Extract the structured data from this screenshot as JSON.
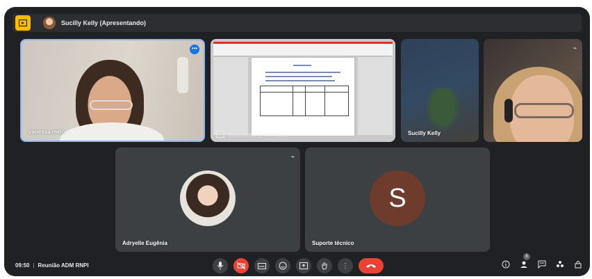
{
  "topbar": {
    "presenter_label": "Sucilly Kelly (Apresentando)"
  },
  "tiles": {
    "vanessa": {
      "name": "vanessa melo"
    },
    "share": {
      "label": "Sucilly Kelly (Apresentação)"
    },
    "sucilly": {
      "name": "Sucilly Kelly"
    },
    "adryelle": {
      "name": "Adryelle Eugênia"
    },
    "suporte": {
      "name": "Suporte técnico",
      "initial": "S"
    }
  },
  "bottombar": {
    "time": "09:50",
    "meeting_name": "Reunião ADM RNPI",
    "participants_count": "6"
  },
  "colors": {
    "background": "#202124",
    "accent_blue": "#8ab4f8",
    "red": "#ea4335",
    "present_badge": "#fbbc04"
  },
  "icons": [
    "present-icon",
    "more-options-icon",
    "mic-off-icon",
    "mic-icon",
    "camera-off-icon",
    "captions-icon",
    "emoji-icon",
    "present-screen-icon",
    "raise-hand-icon",
    "more-vert-icon",
    "end-call-icon",
    "info-icon",
    "people-icon",
    "chat-icon",
    "activities-icon",
    "host-controls-icon"
  ]
}
